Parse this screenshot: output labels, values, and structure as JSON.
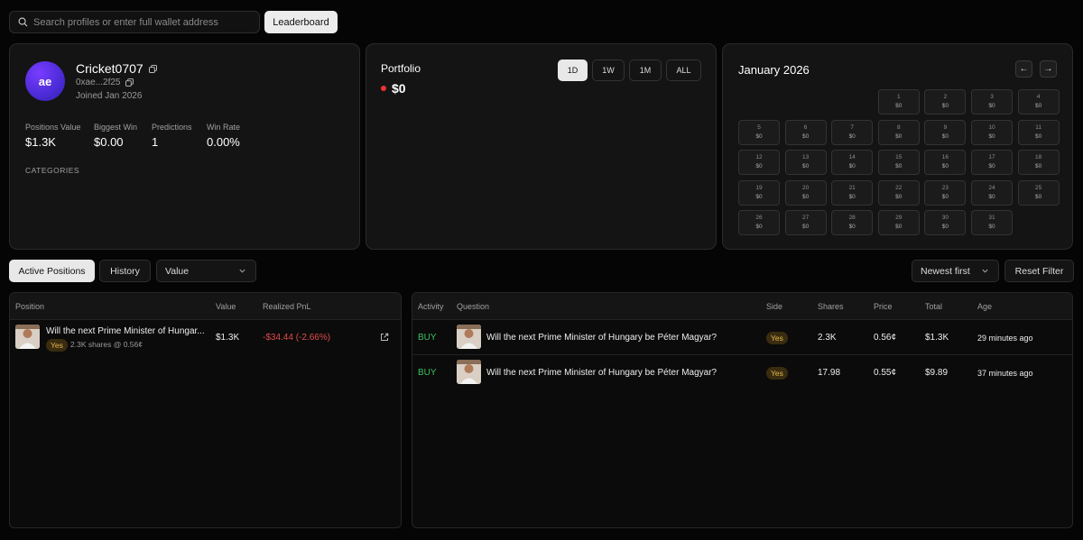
{
  "search": {
    "placeholder": "Search profiles or enter full wallet address",
    "value": ""
  },
  "leaderboard_label": "Leaderboard",
  "profile": {
    "avatar_initials": "ae",
    "username": "Cricket0707",
    "address": "0xae...2f25",
    "joined": "Joined Jan 2026",
    "stats": [
      {
        "label": "Positions Value",
        "value": "$1.3K"
      },
      {
        "label": "Biggest Win",
        "value": "$0.00"
      },
      {
        "label": "Predictions",
        "value": "1"
      },
      {
        "label": "Win Rate",
        "value": "0.00%"
      }
    ],
    "categories_label": "CATEGORIES"
  },
  "portfolio": {
    "title": "Portfolio",
    "value": "$0",
    "status_color": "#e33333",
    "timeframes": [
      "1D",
      "1W",
      "1M",
      "ALL"
    ],
    "active_timeframe": "1D"
  },
  "calendar": {
    "title": "January 2026",
    "prev_icon": "arrow-left-icon",
    "next_icon": "arrow-right-icon",
    "days": [
      {
        "d": "1",
        "v": "$0"
      },
      {
        "d": "2",
        "v": "$0"
      },
      {
        "d": "3",
        "v": "$0"
      },
      {
        "d": "4",
        "v": "$0"
      },
      {
        "d": "5",
        "v": "$0"
      },
      {
        "d": "6",
        "v": "$0"
      },
      {
        "d": "7",
        "v": "$0"
      },
      {
        "d": "8",
        "v": "$0"
      },
      {
        "d": "9",
        "v": "$0"
      },
      {
        "d": "10",
        "v": "$0"
      },
      {
        "d": "11",
        "v": "$0"
      },
      {
        "d": "12",
        "v": "$0"
      },
      {
        "d": "13",
        "v": "$0"
      },
      {
        "d": "14",
        "v": "$0"
      },
      {
        "d": "15",
        "v": "$0"
      },
      {
        "d": "16",
        "v": "$0"
      },
      {
        "d": "17",
        "v": "$0"
      },
      {
        "d": "18",
        "v": "$0"
      },
      {
        "d": "19",
        "v": "$0"
      },
      {
        "d": "20",
        "v": "$0"
      },
      {
        "d": "21",
        "v": "$0"
      },
      {
        "d": "22",
        "v": "$0"
      },
      {
        "d": "23",
        "v": "$0"
      },
      {
        "d": "24",
        "v": "$0"
      },
      {
        "d": "25",
        "v": "$0"
      },
      {
        "d": "26",
        "v": "$0"
      },
      {
        "d": "27",
        "v": "$0"
      },
      {
        "d": "28",
        "v": "$0"
      },
      {
        "d": "29",
        "v": "$0"
      },
      {
        "d": "30",
        "v": "$0"
      },
      {
        "d": "31",
        "v": "$0"
      }
    ]
  },
  "tabs": {
    "active_positions": "Active Positions",
    "history": "History"
  },
  "sort_select": {
    "value": "Value"
  },
  "order_select": {
    "value": "Newest first"
  },
  "reset_filter": "Reset Filter",
  "positions": {
    "columns": [
      "Position",
      "Value",
      "Realized PnL"
    ],
    "rows": [
      {
        "question": "Will the next Prime Minister of Hungar...",
        "side": "Yes",
        "detail": "2.3K shares @ 0.56¢",
        "value": "$1.3K",
        "pnl": "-$34.44 (-2.66%)"
      }
    ]
  },
  "activity": {
    "columns": [
      "Activity",
      "Question",
      "Side",
      "Shares",
      "Price",
      "Total",
      "Age"
    ],
    "rows": [
      {
        "type": "BUY",
        "question": "Will the next Prime Minister of Hungary be Péter Magyar?",
        "side": "Yes",
        "shares": "2.3K",
        "price": "0.56¢",
        "total": "$1.3K",
        "age": "29 minutes ago"
      },
      {
        "type": "BUY",
        "question": "Will the next Prime Minister of Hungary be Péter Magyar?",
        "side": "Yes",
        "shares": "17.98",
        "price": "0.55¢",
        "total": "$9.89",
        "age": "37 minutes ago"
      }
    ]
  }
}
